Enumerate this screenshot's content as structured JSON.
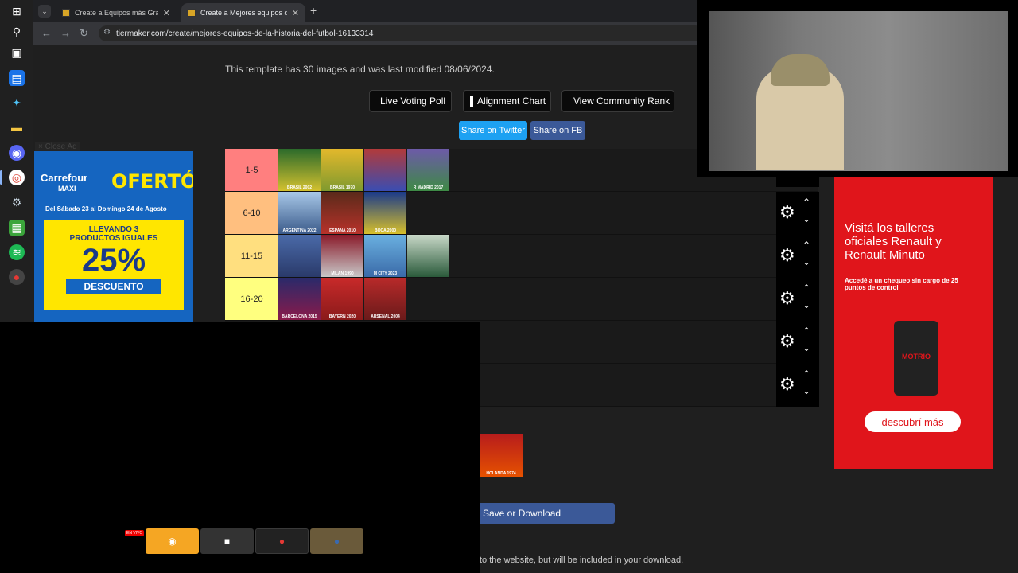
{
  "tabs": [
    {
      "title": "Create a Equipos más Grandes"
    },
    {
      "title": "Create a Mejores equipos de la"
    }
  ],
  "url": "tiermaker.com/create/mejores-equipos-de-la-historia-del-futbol-16133314",
  "template_info": "This template has 30 images and was last modified 08/06/2024.",
  "actions": {
    "live_voting": "Live Voting Poll",
    "alignment_chart": "Alignment Chart",
    "community_rank": "View Community Rank",
    "share_twitter": "Share on Twitter",
    "share_fb": "Share on FB"
  },
  "close_ad": "Close Ad",
  "carrefour_ad": {
    "brand": "Carrefour",
    "brand_sub": "MAXI",
    "headline": "OFERTÓN",
    "dates": "Del Sábado 23 al Domingo 24 de Agosto",
    "promo_line1": "LLEVANDO 3",
    "promo_line2": "PRODUCTOS IGUALES",
    "percent": "25%",
    "descuento": "DESCUENTO"
  },
  "renault_ad": {
    "headline": "Visitá los talleres oficiales Renault y Renault Minuto",
    "sub": "Accedé a un chequeo sin cargo de 25 puntos de control",
    "product": "MOTRIO",
    "cta": "descubrí más"
  },
  "tiers": [
    {
      "label": "1-5",
      "color": "#ff7f7f",
      "items": [
        "BRASIL 2002",
        "BRASIL 1970",
        "",
        "R MADRID 2017"
      ]
    },
    {
      "label": "6-10",
      "color": "#ffbf7f",
      "items": [
        "ARGENTINA 2022",
        "ESPAÑA 2010",
        "BOCA 2000"
      ]
    },
    {
      "label": "11-15",
      "color": "#ffdf7f",
      "items": [
        "",
        "MILAN 1990",
        "M CITY 2023",
        ""
      ]
    },
    {
      "label": "16-20",
      "color": "#ffff7f",
      "items": [
        "BARCELONA 2015",
        "BAYERN 2020",
        "ARSENAL 2004"
      ]
    },
    {
      "label": "",
      "color": "#bfff7f",
      "items": []
    },
    {
      "label": "",
      "color": "#7fff7f",
      "items": []
    }
  ],
  "leftover_item": "HOLANDA 1974",
  "save_button": "Save or Download",
  "bottom_note": "to the website, but will be included in your download.",
  "discord": {
    "live_badge": "EN VIVO"
  }
}
